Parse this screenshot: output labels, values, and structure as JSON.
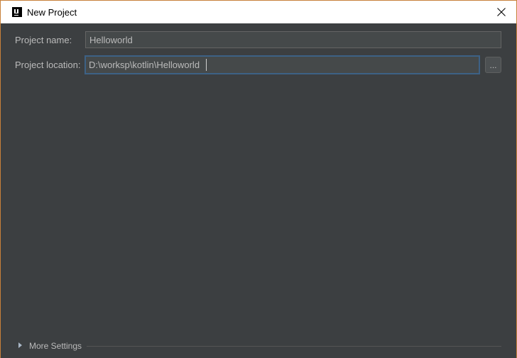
{
  "window": {
    "title": "New Project",
    "logo_text": "IJ",
    "accent_border": "#c8813a",
    "background": "#3c3f41"
  },
  "icons": {
    "app": "intellij-logo-icon",
    "close": "close-icon",
    "expand": "triangle-right-icon"
  },
  "form": {
    "project_name_label": "Project name:",
    "project_name_value": "Helloworld",
    "project_location_label": "Project location:",
    "project_location_value": "D:\\worksp\\kotlin\\Helloworld",
    "browse_label": "..."
  },
  "more_settings": {
    "label": "More Settings",
    "expanded": false
  }
}
